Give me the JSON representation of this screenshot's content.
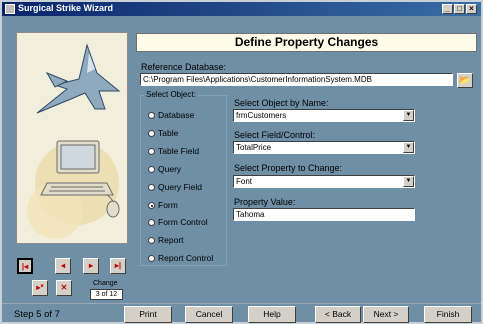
{
  "window": {
    "title": "Surgical Strike Wizard",
    "minimize": "_",
    "maximize": "□",
    "close": "×"
  },
  "header": {
    "title": "Define Property Changes"
  },
  "reference": {
    "label": "Reference Database:",
    "value": "C:\\Program Files\\Applications\\CustomerInformationSystem.MDB"
  },
  "select_object": {
    "label": "Select Object:",
    "options": [
      "Database",
      "Table",
      "Table Field",
      "Query",
      "Query Field",
      "Form",
      "Form Control",
      "Report",
      "Report Control"
    ],
    "selected": "Form"
  },
  "by_name": {
    "label": "Select Object by Name:",
    "value": "frmCustomers"
  },
  "field_control": {
    "label": "Select Field/Control:",
    "value": "TotalPrice"
  },
  "property": {
    "label": "Select Property to Change:",
    "value": "Font"
  },
  "property_value": {
    "label": "Property Value:",
    "value": "Tahoma"
  },
  "change": {
    "label": "Change",
    "counter": "3 of 12"
  },
  "status": {
    "step": "Step 5 of 7"
  },
  "buttons": {
    "print": "Print",
    "cancel": "Cancel",
    "help": "Help",
    "back": "< Back",
    "next": "Next >",
    "finish": "Finish"
  },
  "icons": {
    "browse": "folder-open-icon",
    "art": "jet-and-computer-illustration"
  }
}
